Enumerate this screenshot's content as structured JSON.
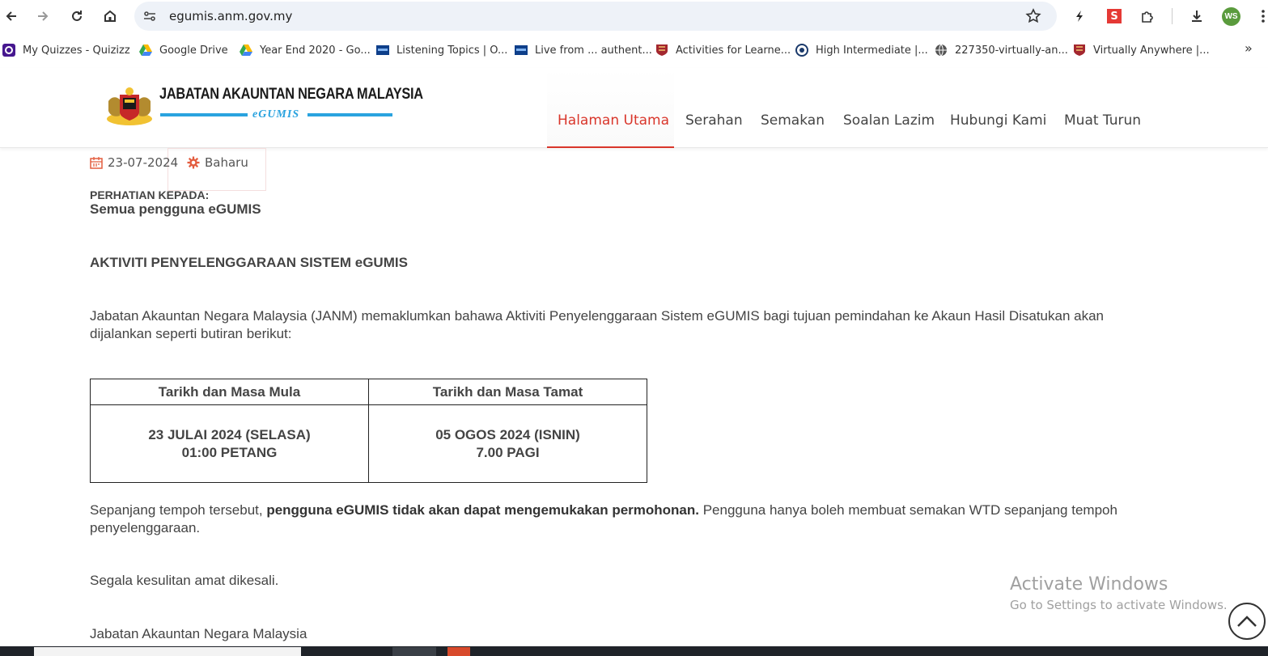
{
  "browser": {
    "url": "egumis.anm.gov.my",
    "profile_initials": "WS",
    "extension_s_label": "S",
    "bookmarks": [
      {
        "label": "My Quizzes - Quizizz",
        "icon": "quizizz-icon"
      },
      {
        "label": "Google Drive",
        "icon": "google-drive-icon"
      },
      {
        "label": "Year End 2020 - Go...",
        "icon": "google-drive-icon"
      },
      {
        "label": "Listening Topics | O...",
        "icon": "site-icon"
      },
      {
        "label": "Live from ... authent...",
        "icon": "site-icon"
      },
      {
        "label": "Activities for Learne...",
        "icon": "cambridge-icon"
      },
      {
        "label": "High Intermediate |...",
        "icon": "globe-target-icon"
      },
      {
        "label": "227350-virtually-an...",
        "icon": "globe-icon"
      },
      {
        "label": "Virtually Anywhere |...",
        "icon": "cambridge-icon"
      }
    ],
    "more_label": "»"
  },
  "site": {
    "logo_title": "JABATAN AKAUNTAN NEGARA MALAYSIA",
    "logo_sub": "eGUMIS",
    "menu": [
      {
        "label": "Halaman Utama",
        "active": true
      },
      {
        "label": "Serahan",
        "active": false
      },
      {
        "label": "Semakan",
        "active": false
      },
      {
        "label": "Soalan Lazim",
        "active": false
      },
      {
        "label": "Hubungi Kami",
        "active": false
      },
      {
        "label": "Muat Turun",
        "active": false
      }
    ],
    "accent_color": "#d9362b"
  },
  "article": {
    "date": "23-07-2024",
    "category": "Baharu",
    "attention_label": "PERHATIAN KEPADA:",
    "attention_target": "Semua pengguna eGUMIS",
    "heading": "AKTIVITI PENYELENGGARAAN SISTEM eGUMIS",
    "intro": "Jabatan Akauntan Negara Malaysia (JANM) memaklumkan bahawa Aktiviti Penyelenggaraan Sistem eGUMIS bagi tujuan pemindahan ke Akaun Hasil Disatukan akan dijalankan seperti butiran berikut:",
    "table": {
      "headers": [
        "Tarikh dan Masa Mula",
        "Tarikh dan Masa Tamat"
      ],
      "start_line1": "23 JULAI 2024 (SELASA)",
      "start_line2": "01:00 PETANG",
      "end_line1": "05 OGOS 2024 (ISNIN)",
      "end_line2": "7.00 PAGI"
    },
    "notice_pre": "Sepanjang tempoh tersebut, ",
    "notice_bold": "pengguna eGUMIS tidak akan dapat mengemukakan permohonan.",
    "notice_post": " Pengguna hanya boleh membuat semakan WTD sepanjang tempoh penyelenggaraan.",
    "apology": "Segala kesulitan amat dikesali.",
    "signoff": "Jabatan Akauntan Negara Malaysia"
  },
  "overlay": {
    "watermark_title": "Activate Windows",
    "watermark_sub": "Go to Settings to activate Windows."
  }
}
